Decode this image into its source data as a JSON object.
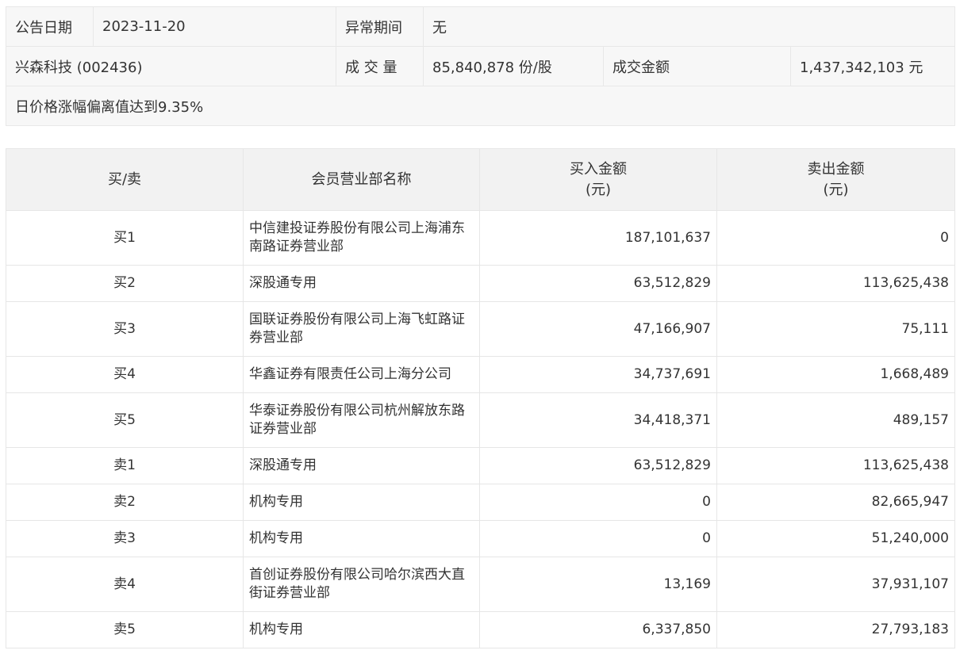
{
  "info": {
    "announce_date_label": "公告日期",
    "announce_date": "2023-11-20",
    "abnormal_period_label": "异常期间",
    "abnormal_period": "无",
    "stock_name": "兴森科技 (002436)",
    "volume_label": "成 交 量",
    "volume": "85,840,878 份/股",
    "turnover_label": "成交金额",
    "turnover": "1,437,342,103 元",
    "reason": "日价格涨幅偏离值达到9.35%"
  },
  "table": {
    "headers": {
      "side": "买/卖",
      "name": "会员营业部名称",
      "buy_line1": "买入金额",
      "buy_line2": "(元)",
      "sell_line1": "卖出金额",
      "sell_line2": "(元)"
    },
    "rows": [
      {
        "side": "买1",
        "name": "中信建投证券股份有限公司上海浦东南路证券营业部",
        "buy": "187,101,637",
        "sell": "0"
      },
      {
        "side": "买2",
        "name": "深股通专用",
        "buy": "63,512,829",
        "sell": "113,625,438"
      },
      {
        "side": "买3",
        "name": "国联证券股份有限公司上海飞虹路证券营业部",
        "buy": "47,166,907",
        "sell": "75,111"
      },
      {
        "side": "买4",
        "name": "华鑫证券有限责任公司上海分公司",
        "buy": "34,737,691",
        "sell": "1,668,489"
      },
      {
        "side": "买5",
        "name": "华泰证券股份有限公司杭州解放东路证券营业部",
        "buy": "34,418,371",
        "sell": "489,157"
      },
      {
        "side": "卖1",
        "name": "深股通专用",
        "buy": "63,512,829",
        "sell": "113,625,438"
      },
      {
        "side": "卖2",
        "name": "机构专用",
        "buy": "0",
        "sell": "82,665,947"
      },
      {
        "side": "卖3",
        "name": "机构专用",
        "buy": "0",
        "sell": "51,240,000"
      },
      {
        "side": "卖4",
        "name": "首创证券股份有限公司哈尔滨西大直街证券营业部",
        "buy": "13,169",
        "sell": "37,931,107"
      },
      {
        "side": "卖5",
        "name": "机构专用",
        "buy": "6,337,850",
        "sell": "27,793,183"
      }
    ]
  }
}
